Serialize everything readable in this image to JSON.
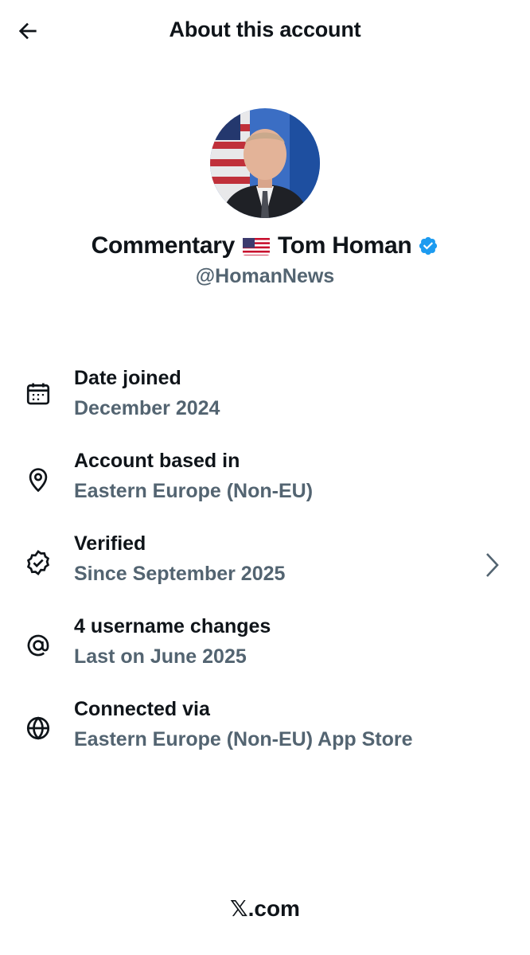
{
  "header": {
    "title": "About this account",
    "back_icon": "arrow-left-icon"
  },
  "profile": {
    "name_prefix": "Commentary",
    "flag_emoji": "🇺🇸",
    "name_suffix": "Tom Homan",
    "handle": "@HomanNews",
    "verified_color": "#1d9bf0"
  },
  "info": [
    {
      "icon": "calendar-icon",
      "title": "Date joined",
      "subtitle": "December 2024"
    },
    {
      "icon": "location-pin-icon",
      "title": "Account based in",
      "subtitle": "Eastern Europe (Non-EU)"
    },
    {
      "icon": "verified-badge-icon",
      "title": "Verified",
      "subtitle": "Since September 2025"
    },
    {
      "icon": "at-sign-icon",
      "title": "4 username changes",
      "subtitle": "Last on June 2025"
    },
    {
      "icon": "globe-icon",
      "title": "Connected via",
      "subtitle": "Eastern Europe (Non-EU) App Store"
    }
  ],
  "footer": {
    "brand": "𝕏.com"
  },
  "colors": {
    "text_primary": "#0f1419",
    "text_secondary": "#536471",
    "background": "#ffffff"
  }
}
